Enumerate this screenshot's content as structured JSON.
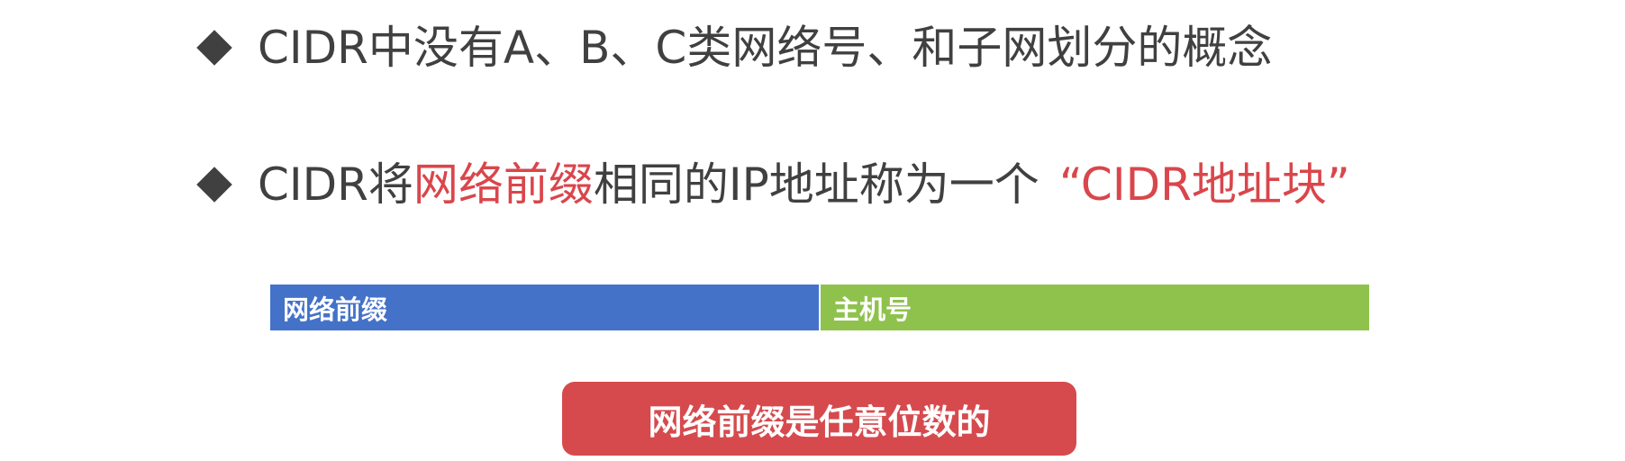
{
  "slide": {
    "bullet1": {
      "text": "CIDR中没有A、B、C类网络号、和子网划分的概念"
    },
    "bullet2": {
      "part1": "CIDR将",
      "part2_highlight": "网络前缀",
      "part3": "相同的IP地址称为一个",
      "part4_highlight": "“CIDR地址块”"
    },
    "address_bar": {
      "prefix_label": "网络前缀",
      "host_label": "主机号"
    },
    "callout": {
      "text": "网络前缀是任意位数的"
    }
  },
  "colors": {
    "text": "#404040",
    "highlight_red": "#d9464b",
    "prefix_blue": "#4472c9",
    "host_green": "#8fc24d",
    "callout_red": "#d64a4e"
  },
  "icons": {
    "bullet": "diamond-bullet-icon"
  }
}
